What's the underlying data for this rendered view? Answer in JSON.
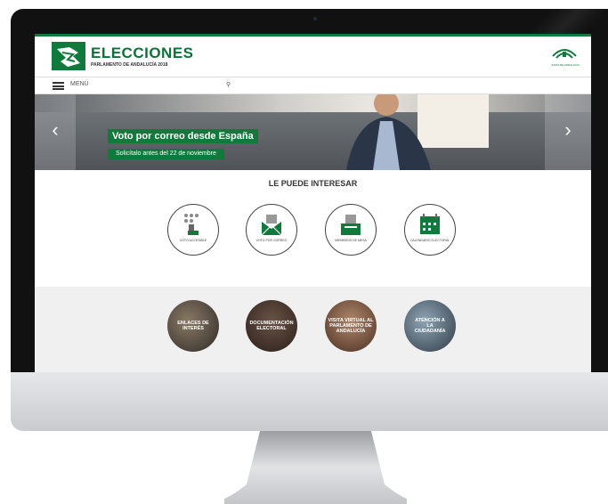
{
  "header": {
    "logo_title": "ELECCIONES",
    "logo_subtitle": "PARLAMENTO DE ANDALUCÍA 2018",
    "junta_label": "JUNTA DE ANDALUCIA"
  },
  "nav": {
    "menu_label": "MENÚ",
    "search_icon": "search-icon"
  },
  "hero": {
    "title": "Voto por correo desde España",
    "subtitle": "Solicítalo antes del 22 de noviembre"
  },
  "interest": {
    "title": "LE PUEDE INTERESAR",
    "items": [
      {
        "label": "VOTO ACCESIBLE",
        "icon": "braille-hand-icon"
      },
      {
        "label": "VOTO POR CORREO",
        "icon": "envelope-icon"
      },
      {
        "label": "MIEMBROS DE MESA",
        "icon": "ballot-box-icon"
      },
      {
        "label": "CALENDARIO ELECTORAL",
        "icon": "calendar-icon"
      }
    ]
  },
  "links": [
    {
      "label": "ENLACES DE INTERÉS"
    },
    {
      "label": "DOCUMENTACIÓN ELECTORAL"
    },
    {
      "label": "VISITA VIRTUAL AL PARLAMENTO DE ANDALUCÍA"
    },
    {
      "label": "ATENCIÓN A LA CIUDADANÍA"
    }
  ],
  "colors": {
    "brand_green": "#0f7a3c",
    "band_gray": "#f0f0f0"
  }
}
